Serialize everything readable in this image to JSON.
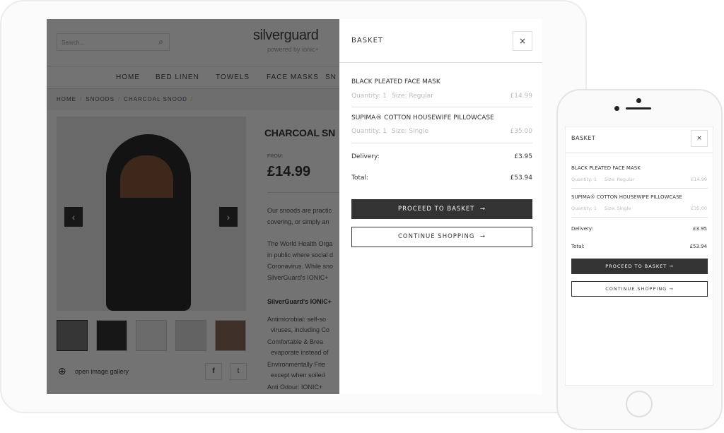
{
  "site": {
    "search_placeholder": "Search...",
    "logo_text": "silverguard",
    "logo_sub": "powered by ionic+",
    "nav": [
      "HOME",
      "BED LINEN",
      "TOWELS",
      "FACE MASKS",
      "SN"
    ],
    "breadcrumb": [
      "HOME",
      "SNOODS",
      "CHARCOAL SNOOD"
    ],
    "product_title": "CHARCOAL SN",
    "from_label": "FROM:",
    "price": "£14.99",
    "paragraphs": [
      "Our snoods are practic",
      "covering, or simply an",
      "The World Health Orga",
      "in public where social d",
      "Coronavirus. While sno",
      "SilverGuard's IONIC+"
    ],
    "features_heading": "SilverGuard's IONIC+",
    "bullets": [
      "Antimicrobial: self-so",
      "viruses, including Co",
      "Comfortable & Brea",
      "evaporate instead of",
      "Environmentally Frie",
      "except when soiled",
      "Anti Odour: IONIC+"
    ],
    "gallery_label": "open image gallery",
    "accent": "#e6c22a"
  },
  "basket": {
    "title": "BASKET",
    "close": "×",
    "items": [
      {
        "name": "BLACK PLEATED FACE MASK",
        "quantity": "Quantity: 1",
        "size": "Size: Regular",
        "price": "£14.99"
      },
      {
        "name": "SUPIMA® COTTON HOUSEWIFE PILLOWCASE",
        "quantity": "Quantity: 1",
        "size": "Size: Single",
        "price": "£35.00"
      }
    ],
    "delivery_label": "Delivery:",
    "delivery": "£3.95",
    "total_label": "Total:",
    "total": "£53.94",
    "proceed": "PROCEED TO BASKET",
    "continue": "CONTINUE SHOPPING",
    "arrow": "→"
  }
}
